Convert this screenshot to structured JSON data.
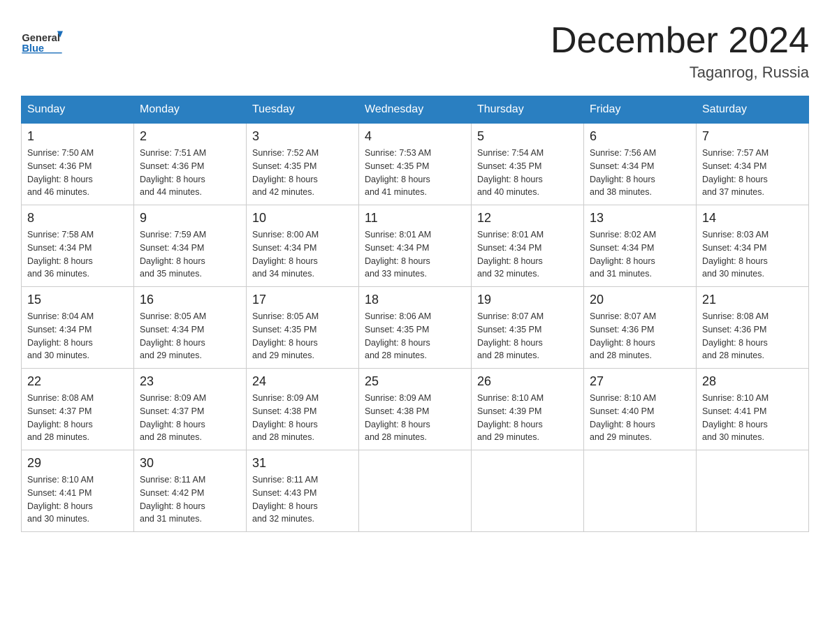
{
  "header": {
    "logo_general": "General",
    "logo_blue": "Blue",
    "month_title": "December 2024",
    "location": "Taganrog, Russia"
  },
  "days_of_week": [
    "Sunday",
    "Monday",
    "Tuesday",
    "Wednesday",
    "Thursday",
    "Friday",
    "Saturday"
  ],
  "weeks": [
    [
      {
        "day": "1",
        "sunrise": "7:50 AM",
        "sunset": "4:36 PM",
        "daylight": "8 hours and 46 minutes."
      },
      {
        "day": "2",
        "sunrise": "7:51 AM",
        "sunset": "4:36 PM",
        "daylight": "8 hours and 44 minutes."
      },
      {
        "day": "3",
        "sunrise": "7:52 AM",
        "sunset": "4:35 PM",
        "daylight": "8 hours and 42 minutes."
      },
      {
        "day": "4",
        "sunrise": "7:53 AM",
        "sunset": "4:35 PM",
        "daylight": "8 hours and 41 minutes."
      },
      {
        "day": "5",
        "sunrise": "7:54 AM",
        "sunset": "4:35 PM",
        "daylight": "8 hours and 40 minutes."
      },
      {
        "day": "6",
        "sunrise": "7:56 AM",
        "sunset": "4:34 PM",
        "daylight": "8 hours and 38 minutes."
      },
      {
        "day": "7",
        "sunrise": "7:57 AM",
        "sunset": "4:34 PM",
        "daylight": "8 hours and 37 minutes."
      }
    ],
    [
      {
        "day": "8",
        "sunrise": "7:58 AM",
        "sunset": "4:34 PM",
        "daylight": "8 hours and 36 minutes."
      },
      {
        "day": "9",
        "sunrise": "7:59 AM",
        "sunset": "4:34 PM",
        "daylight": "8 hours and 35 minutes."
      },
      {
        "day": "10",
        "sunrise": "8:00 AM",
        "sunset": "4:34 PM",
        "daylight": "8 hours and 34 minutes."
      },
      {
        "day": "11",
        "sunrise": "8:01 AM",
        "sunset": "4:34 PM",
        "daylight": "8 hours and 33 minutes."
      },
      {
        "day": "12",
        "sunrise": "8:01 AM",
        "sunset": "4:34 PM",
        "daylight": "8 hours and 32 minutes."
      },
      {
        "day": "13",
        "sunrise": "8:02 AM",
        "sunset": "4:34 PM",
        "daylight": "8 hours and 31 minutes."
      },
      {
        "day": "14",
        "sunrise": "8:03 AM",
        "sunset": "4:34 PM",
        "daylight": "8 hours and 30 minutes."
      }
    ],
    [
      {
        "day": "15",
        "sunrise": "8:04 AM",
        "sunset": "4:34 PM",
        "daylight": "8 hours and 30 minutes."
      },
      {
        "day": "16",
        "sunrise": "8:05 AM",
        "sunset": "4:34 PM",
        "daylight": "8 hours and 29 minutes."
      },
      {
        "day": "17",
        "sunrise": "8:05 AM",
        "sunset": "4:35 PM",
        "daylight": "8 hours and 29 minutes."
      },
      {
        "day": "18",
        "sunrise": "8:06 AM",
        "sunset": "4:35 PM",
        "daylight": "8 hours and 28 minutes."
      },
      {
        "day": "19",
        "sunrise": "8:07 AM",
        "sunset": "4:35 PM",
        "daylight": "8 hours and 28 minutes."
      },
      {
        "day": "20",
        "sunrise": "8:07 AM",
        "sunset": "4:36 PM",
        "daylight": "8 hours and 28 minutes."
      },
      {
        "day": "21",
        "sunrise": "8:08 AM",
        "sunset": "4:36 PM",
        "daylight": "8 hours and 28 minutes."
      }
    ],
    [
      {
        "day": "22",
        "sunrise": "8:08 AM",
        "sunset": "4:37 PM",
        "daylight": "8 hours and 28 minutes."
      },
      {
        "day": "23",
        "sunrise": "8:09 AM",
        "sunset": "4:37 PM",
        "daylight": "8 hours and 28 minutes."
      },
      {
        "day": "24",
        "sunrise": "8:09 AM",
        "sunset": "4:38 PM",
        "daylight": "8 hours and 28 minutes."
      },
      {
        "day": "25",
        "sunrise": "8:09 AM",
        "sunset": "4:38 PM",
        "daylight": "8 hours and 28 minutes."
      },
      {
        "day": "26",
        "sunrise": "8:10 AM",
        "sunset": "4:39 PM",
        "daylight": "8 hours and 29 minutes."
      },
      {
        "day": "27",
        "sunrise": "8:10 AM",
        "sunset": "4:40 PM",
        "daylight": "8 hours and 29 minutes."
      },
      {
        "day": "28",
        "sunrise": "8:10 AM",
        "sunset": "4:41 PM",
        "daylight": "8 hours and 30 minutes."
      }
    ],
    [
      {
        "day": "29",
        "sunrise": "8:10 AM",
        "sunset": "4:41 PM",
        "daylight": "8 hours and 30 minutes."
      },
      {
        "day": "30",
        "sunrise": "8:11 AM",
        "sunset": "4:42 PM",
        "daylight": "8 hours and 31 minutes."
      },
      {
        "day": "31",
        "sunrise": "8:11 AM",
        "sunset": "4:43 PM",
        "daylight": "8 hours and 32 minutes."
      },
      null,
      null,
      null,
      null
    ]
  ],
  "labels": {
    "sunrise": "Sunrise:",
    "sunset": "Sunset:",
    "daylight": "Daylight:"
  }
}
